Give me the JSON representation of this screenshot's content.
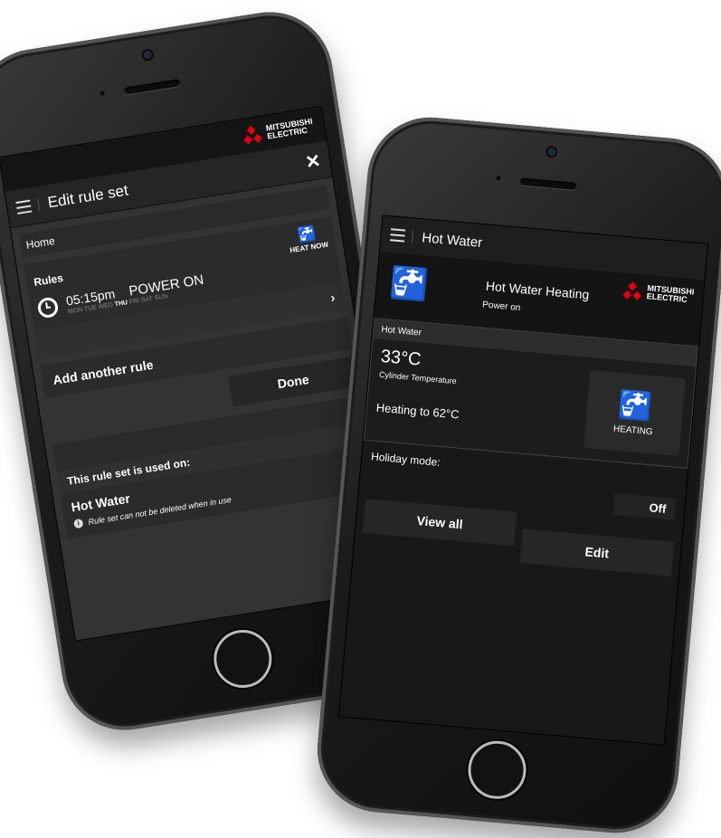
{
  "brand": {
    "name_line1": "MITSUBISHI",
    "name_line2": "ELECTRIC",
    "accent": "#e60012"
  },
  "left_screen": {
    "title": "Edit rule set",
    "close_icon": "close-icon",
    "home_label": "Home",
    "rules_header": "Rules",
    "heat_now_label": "HEAT NOW",
    "rule": {
      "time": "05:15pm",
      "action": "POWER ON",
      "days": [
        "MON",
        "TUE",
        "WED",
        "THU",
        "FRI",
        "SAT",
        "SUN"
      ],
      "active_day": "THU"
    },
    "add_rule_label": "Add another rule",
    "done_label": "Done",
    "used_on_label": "This rule set is used on:",
    "used_item": "Hot Water",
    "info_text": "Rule set can not be deleted when in use"
  },
  "right_screen": {
    "title": "Hot Water",
    "device_name": "Hot Water Heating",
    "device_status": "Power on",
    "section_label": "Hot Water",
    "temperature": "33°C",
    "temperature_label": "Cylinder Temperature",
    "heating_target": "Heating to 62°C",
    "heating_tile_label": "HEATING",
    "holiday_label": "Holiday mode:",
    "holiday_value": "Off",
    "view_all_label": "View all",
    "edit_label": "Edit"
  }
}
